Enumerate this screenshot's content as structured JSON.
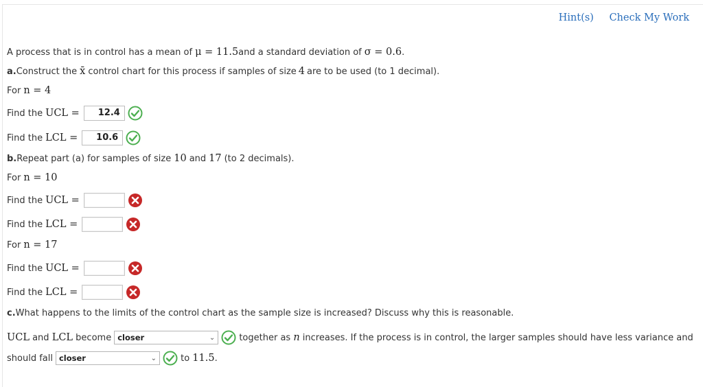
{
  "toplinks": {
    "hint": "Hint(s)",
    "check": "Check My Work"
  },
  "intro": {
    "t1": "A process that is in control has a mean of ",
    "mu_expr": "μ = 11.5",
    "t2": " and a standard deviation of ",
    "sigma_expr": "σ = 0.6",
    "t3": "."
  },
  "part_a": {
    "letter": "a.",
    "t1": " Construct the ",
    "xbar": "x̄",
    "t2": " control chart for this process if samples of size ",
    "size": "4",
    "t3": " are to be used (to 1 decimal).",
    "for_label": "For ",
    "n_expr": "n = 4",
    "ucl_prefix": "Find the ",
    "ucl_math": "UCL =",
    "ucl_value": "12.4",
    "lcl_prefix": "Find the ",
    "lcl_math": "LCL =",
    "lcl_value": "10.6"
  },
  "part_b": {
    "letter": "b.",
    "t1": " Repeat part (a) for samples of size ",
    "size1": "10",
    "t2": " and ",
    "size2": "17",
    "t3": " (to 2 decimals).",
    "for_label": "For ",
    "n10_expr": "n = 10",
    "n17_expr": "n = 17",
    "find": "Find the ",
    "ucl_math": "UCL =",
    "lcl_math": "LCL ="
  },
  "part_c": {
    "letter": "c.",
    "question": " What happens to the limits of the control chart as the sample size is increased? Discuss why this is reasonable.",
    "ucl": "UCL",
    "and": " and ",
    "lcl": "LCL",
    "become": " become",
    "select1_value": "closer",
    "t_together": " together as ",
    "n": "n",
    "t_rest": " increases. If the process is in control, the larger samples should have less variance and",
    "should_fall": "should fall",
    "select2_value": "closer",
    "to": " to ",
    "target": "11.5",
    "period": "."
  },
  "colors": {
    "correct": "#4caf50",
    "incorrect": "#c62828",
    "link": "#2a6ebb"
  },
  "icons": {
    "correct": "check-circle-icon",
    "incorrect": "x-circle-icon"
  }
}
